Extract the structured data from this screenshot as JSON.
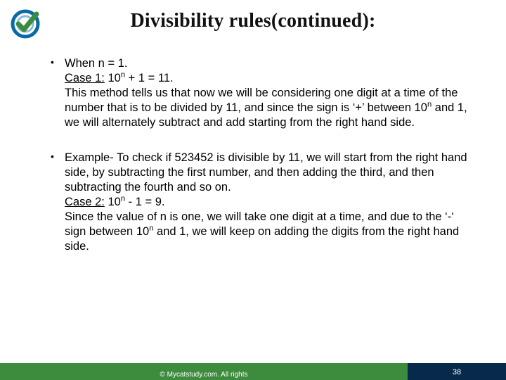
{
  "title": "Divisibility rules(continued):",
  "bullets": [
    {
      "lead": "When n = 1.",
      "case_label": "Case 1:",
      "case_expr_html": "10<sup>n</sup> + 1 = 11.",
      "rest_html": "This method tells us that now we will be considering one digit at a time of the number that is to be divided by 11, and since the sign is ‘+’ between 10<sup>n</sup> and 1, we will alternately subtract and add starting from the right hand side."
    },
    {
      "lead": "Example- To check if 523452 is divisible by 11, we will start from the right hand side, by subtracting the first number, and then adding the third, and then subtracting the fourth and so on.",
      "case_label": "Case 2:",
      "case_expr_html": "10<sup>n</sup> - 1 = 9.",
      "rest_html": "Since the value of n is one, we will take one digit at a time, and due to the ‘-‘ sign between 10<sup>n</sup> and 1, we will keep on adding the digits from the right hand side."
    }
  ],
  "footer": {
    "copyright": "© Mycatstudy.com. All rights",
    "page_num": "38"
  },
  "logo": {
    "name": "checkmark-logo",
    "ring_color": "#0b6aa3",
    "check_color": "#3d8b3d"
  }
}
